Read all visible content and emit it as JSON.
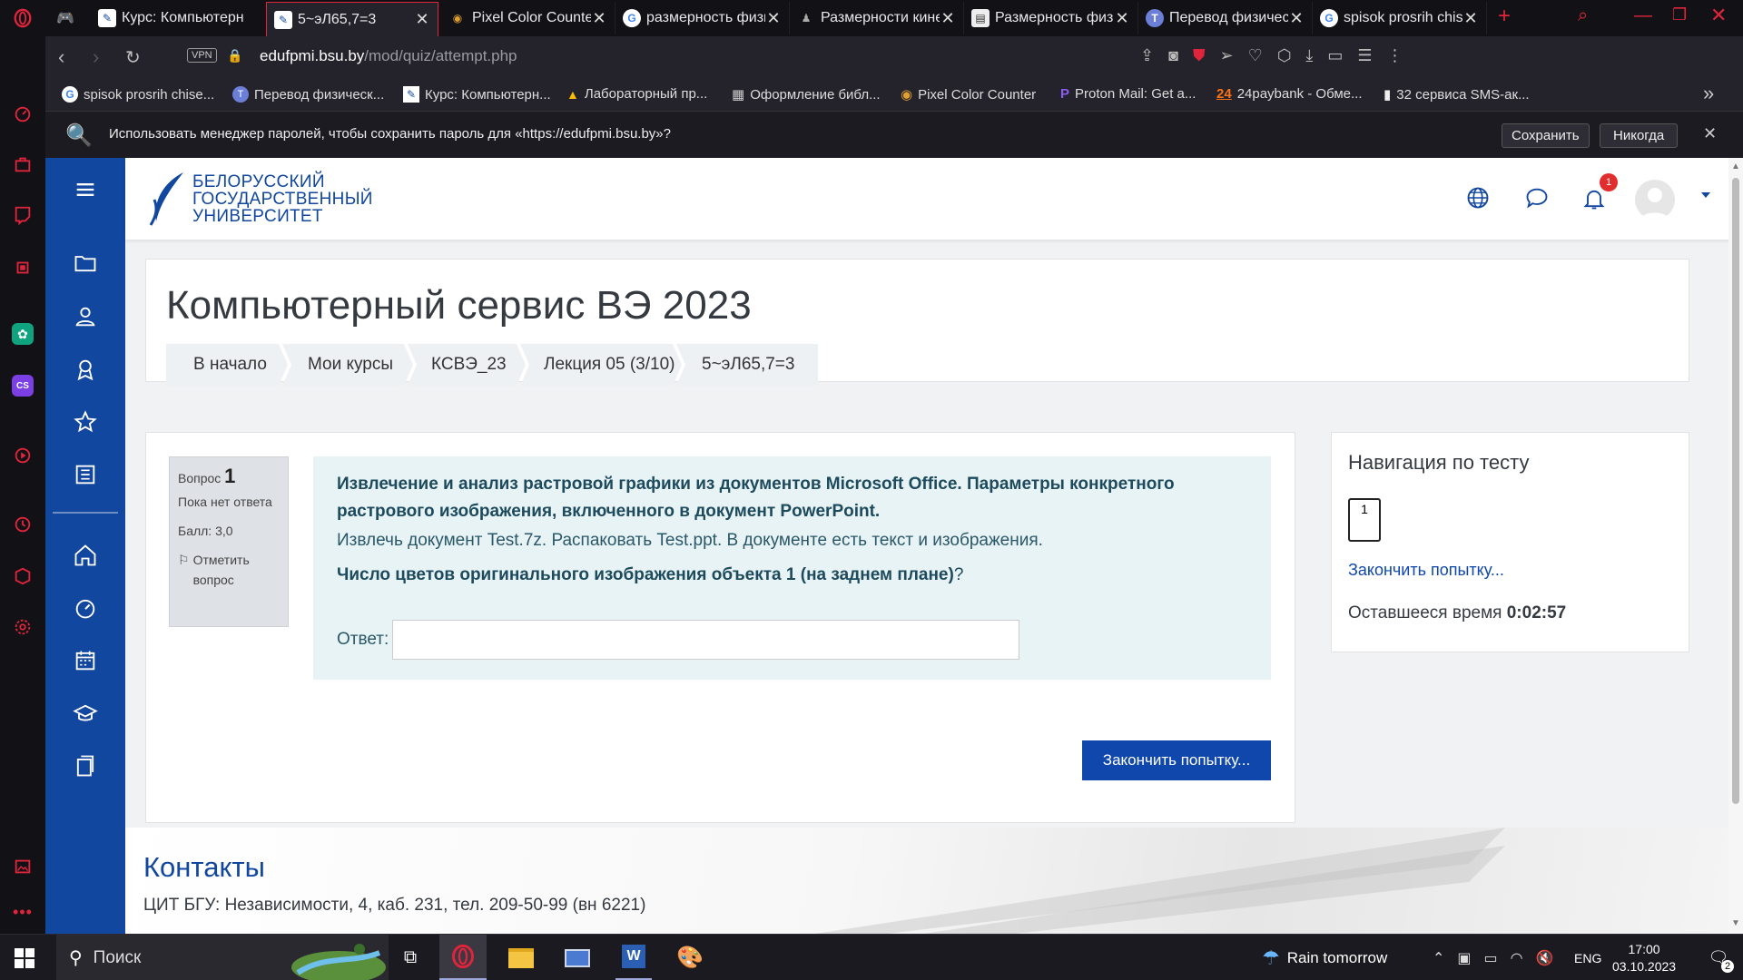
{
  "browser": {
    "tabs": [
      {
        "title": "Курс: Компьютерн",
        "favicon": "moodle-icon"
      },
      {
        "title": "5~эЛ65,7=3",
        "favicon": "moodle-icon",
        "active": true
      },
      {
        "title": "Pixel Color Counte",
        "favicon": "pixel-counter-icon"
      },
      {
        "title": "размерность физи",
        "favicon": "google-icon"
      },
      {
        "title": "Размерности кине",
        "favicon": "figure-icon"
      },
      {
        "title": "Размерность физи",
        "favicon": "page-icon"
      },
      {
        "title": "Перевод физическ",
        "favicon": "translate-icon"
      },
      {
        "title": "spisok prosrih chis",
        "favicon": "google-icon"
      }
    ],
    "new_tab": "+",
    "vpn_badge": "VPN",
    "url_host": "edufpmi.bsu.by",
    "url_path": "/mod/quiz/attempt.php",
    "bookmarks": [
      "spisok prosrih chise...",
      "Перевод физическ...",
      "Курс: Компьютерн...",
      "Лабораторный пр...",
      "Оформление библ...",
      "Pixel Color Counter",
      "Proton Mail: Get a...",
      "24paybank - Обме...",
      "32 сервиса SMS-ак..."
    ],
    "bookmark_24": "24",
    "bookmark_more": "»",
    "password_prompt": "Использовать менеджер паролей, чтобы сохранить пароль для «https://edufpmi.bsu.by»?",
    "save_label": "Сохранить",
    "never_label": "Никогда"
  },
  "site": {
    "logo_line1": "БЕЛОРУССКИЙ",
    "logo_line2": "ГОСУДАРСТВЕННЫЙ",
    "logo_line3": "УНИВЕРСИТЕТ",
    "notif_count": "1"
  },
  "page": {
    "title": "Компьютерный сервис ВЭ 2023",
    "breadcrumbs": [
      "В начало",
      "Мои курсы",
      "КСВЭ_23",
      "Лекция 05 (3/10)",
      "5~эЛ65,7=3"
    ]
  },
  "question": {
    "label": "Вопрос",
    "number": "1",
    "status": "Пока нет ответа",
    "score": "Балл: 3,0",
    "flag": "Отметить вопрос",
    "heading": "Извлечение и анализ растровой графики из документов Microsoft Office. Параметры конкретного растрового изображения, включенного в документ PowerPoint.",
    "instruction": "Извлечь документ Test.7z. Распаковать Test.ppt. В документе есть текст и изображения.",
    "prompt": "Число цветов оригинального изображения объекта 1 (на заднем плане)",
    "prompt_mark": "?",
    "answer_label": "Ответ:",
    "answer_value": "",
    "finish_button": "Закончить попытку..."
  },
  "quiz_nav": {
    "title": "Навигация по тесту",
    "qnum": "1",
    "finish_link": "Закончить попытку...",
    "time_label": "Оставшееся время",
    "time_value": "0:02:57"
  },
  "footer": {
    "title": "Контакты",
    "text": "ЦИТ БГУ: Независимости, 4, каб. 231, тел. 209-50-99 (вн 6221)"
  },
  "taskbar": {
    "search": "Поиск",
    "weather": "Rain tomorrow",
    "lang": "ENG",
    "time": "17:00",
    "date": "03.10.2023",
    "notif": "2"
  },
  "colors": {
    "moodle_blue": "#11479e",
    "opera_red": "#e0243b",
    "question_bg": "#e7f3f5",
    "info_bg": "#dee2e6"
  }
}
